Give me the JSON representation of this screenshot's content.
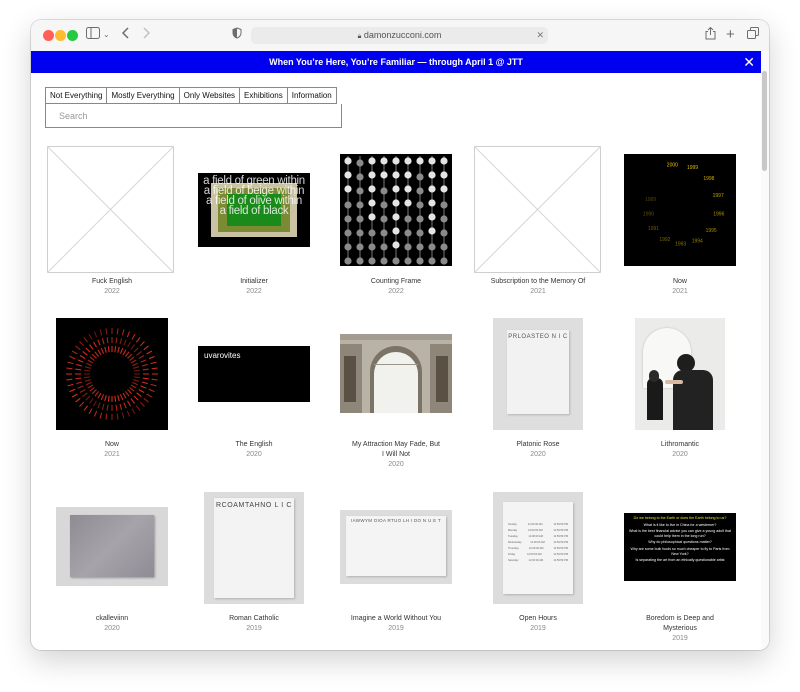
{
  "browser": {
    "url": "damonzucconi.com"
  },
  "banner": {
    "text": "When You’re Here, You’re Familiar — through April 1 @ JTT",
    "close": "✕"
  },
  "filters": [
    {
      "label": "Not Everything"
    },
    {
      "label": "Mostly Everything"
    },
    {
      "label": "Only Websites"
    },
    {
      "label": "Exhibitions"
    },
    {
      "label": "Information"
    }
  ],
  "search": {
    "placeholder": "Search"
  },
  "works": [
    {
      "title": "Fuck English",
      "year": "2022"
    },
    {
      "title": "Initializer",
      "year": "2022",
      "thumb_text": "a field of green within a field of beige within a field of olive within a field of black"
    },
    {
      "title": "Counting Frame",
      "year": "2022"
    },
    {
      "title": "Subscription to the Memory Of",
      "year": "2021"
    },
    {
      "title": "Now",
      "year": "2021",
      "dial_text": [
        "2000",
        "1999",
        "1998",
        "1997",
        "1996",
        "1995",
        "1994",
        "1993",
        "1992",
        "1991",
        "1990",
        "1989"
      ]
    },
    {
      "title": "Now",
      "year": "2021"
    },
    {
      "title": "The English",
      "year": "2020",
      "thumb_text": "uvarovites"
    },
    {
      "title": "My Attraction May Fade, But I Will Not",
      "year": "2020"
    },
    {
      "title": "Platonic Rose",
      "year": "2020",
      "thumb_text": "PRLOASTEO N I C"
    },
    {
      "title": "Lithromantic",
      "year": "2020"
    },
    {
      "title": "ckalleviinn",
      "year": "2020"
    },
    {
      "title": "Roman Catholic",
      "year": "2019",
      "thumb_text": "RCOAMTAHNO L I C"
    },
    {
      "title": "Imagine a World Without You",
      "year": "2019",
      "thumb_text": "IAWWYM OIOA RTUO LH I DO N U E T"
    },
    {
      "title": "Open Hours",
      "year": "2019",
      "hours": [
        {
          "day": "Sunday",
          "open": "12:00:00 AM",
          "close": "11:59:59 PM"
        },
        {
          "day": "Monday",
          "open": "12:00:00 AM",
          "close": "11:59:59 PM"
        },
        {
          "day": "Tuesday",
          "open": "12:00:00 AM",
          "close": "11:59:59 PM"
        },
        {
          "day": "Wednesday",
          "open": "12:00:00 AM",
          "close": "11:59:59 PM"
        },
        {
          "day": "Thursday",
          "open": "12:00:00 AM",
          "close": "11:59:59 PM"
        },
        {
          "day": "Friday",
          "open": "12:00:00 AM",
          "close": "11:59:59 PM"
        },
        {
          "day": "Saturday",
          "open": "12:00:00 AM",
          "close": "11:59:59 PM"
        }
      ]
    },
    {
      "title": "Boredom is Deep and Mysterious",
      "year": "2019",
      "questions": [
        "Do we belong to the Earth or does the Earth belong to us?",
        "What is it like to live in China for a westerner?",
        "What is the best financial advice you can give a young adult that could help them in the long run?",
        "Why do philosophical questions matter?",
        "Why are some bulk foods so much cheaper to fly to Paris from New York?",
        "Is separating the art from an ethically questionable artist"
      ]
    }
  ],
  "colors": {
    "banner_bg": "#0000f0",
    "dial_text": "#e8c400",
    "ring_text": "#e0301e",
    "question_highlight": "#f5e11c"
  }
}
